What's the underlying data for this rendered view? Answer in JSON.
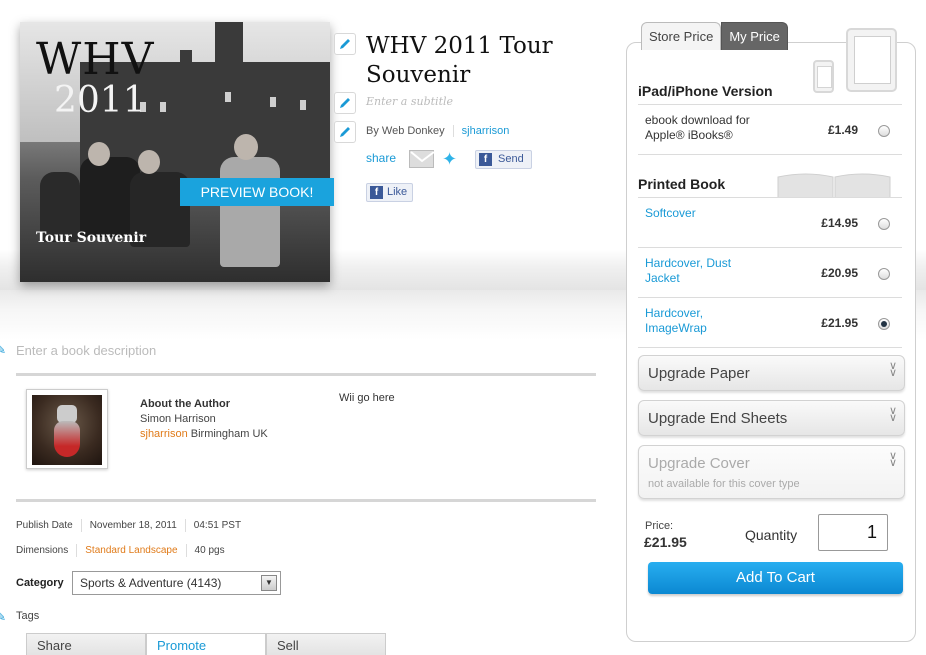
{
  "cover": {
    "title_big": "WHV",
    "year": "2011",
    "subtitle": "Tour Souvenir",
    "preview_label": "PREVIEW BOOK!"
  },
  "book": {
    "title": "WHV 2011 Tour Souvenir",
    "subtitle_placeholder": "Enter a subtitle",
    "by_label": "By Web Donkey",
    "username": "sjharrison",
    "share_label": "share",
    "send_label": "Send",
    "like_label": "Like"
  },
  "pricing": {
    "tabs": [
      {
        "label": "Store Price",
        "active": false
      },
      {
        "label": "My Price",
        "active": true
      }
    ],
    "ipad_heading": "iPad/iPhone Version",
    "ebook_option": {
      "label": "ebook download for Apple® iBooks®",
      "price": "£1.49",
      "selected": false
    },
    "printed_heading": "Printed Book",
    "print_options": [
      {
        "label": "Softcover",
        "price": "£14.95",
        "selected": false
      },
      {
        "label": "Hardcover, Dust Jacket",
        "price": "£20.95",
        "selected": false
      },
      {
        "label": "Hardcover, ImageWrap",
        "price": "£21.95",
        "selected": true
      }
    ],
    "upgrades": [
      {
        "label": "Upgrade Paper",
        "enabled": true
      },
      {
        "label": "Upgrade End Sheets",
        "enabled": true
      },
      {
        "label": "Upgrade Cover",
        "enabled": false,
        "note": "not available for this cover type"
      }
    ],
    "price_label": "Price:",
    "price_value": "£21.95",
    "quantity_label": "Quantity",
    "quantity_value": "1",
    "add_to_cart": "Add To Cart"
  },
  "details": {
    "description_placeholder": "Enter a book description",
    "about_heading": "About the Author",
    "author_name": "Simon Harrison",
    "author_user": "sjharrison",
    "author_location": "Birmingham UK",
    "author_note": "Wii go here",
    "publish_label": "Publish Date",
    "publish_date": "November 18, 2011",
    "publish_time": "04:51 PST",
    "dimensions_label": "Dimensions",
    "dimensions_value": "Standard Landscape",
    "pages": "40 pgs",
    "category_label": "Category",
    "category_value": "Sports & Adventure (4143)",
    "tags_label": "Tags",
    "bottom_tabs": [
      "Share",
      "Promote",
      "Sell"
    ]
  },
  "colors": {
    "accent_blue": "#1a9ad6",
    "preview_blue": "#1aa3dd",
    "cart_blue": "#0b88d2",
    "orange_link": "#e07b1a"
  }
}
